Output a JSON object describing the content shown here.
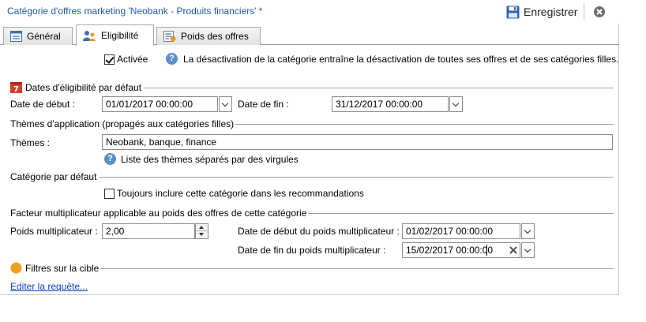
{
  "window": {
    "title": "Catégorie d'offres marketing 'Neobank - Produits financiers' *",
    "save_label": "Enregistrer",
    "accent_color": "#1f5aa8"
  },
  "tabs": [
    {
      "label": "Général",
      "icon": "general-icon",
      "active": false
    },
    {
      "label": "Eligibilité",
      "icon": "eligibility-icon",
      "active": true
    },
    {
      "label": "Poids des offres",
      "icon": "weight-icon",
      "active": false
    }
  ],
  "activation": {
    "label": "Activée",
    "checked": true,
    "info": "La désactivation de la catégorie entraîne la désactivation de toutes ses offres et de ses catégories filles."
  },
  "dates": {
    "section": "Dates d'éligibilité par défaut",
    "start_label": "Date de début :",
    "start_value": "01/01/2017 00:00:00",
    "end_label": "Date de fin :",
    "end_value": "31/12/2017 00:00:00"
  },
  "themes": {
    "section": "Thèmes d'application (propagés aux catégories filles)",
    "label": "Thèmes :",
    "value": "Neobank, banque, finance",
    "hint": "Liste des thèmes séparés par des virgules"
  },
  "default_category": {
    "section": "Catégorie par défaut",
    "checkbox_label": "Toujours inclure cette catégorie dans les recommandations",
    "checked": false
  },
  "multiplier": {
    "section": "Facteur multiplicateur applicable au poids des offres de cette catégorie",
    "weight_label": "Poids multiplicateur :",
    "weight_value": "2,00",
    "start_label": "Date de début du poids multiplicateur :",
    "start_value": "01/02/2017 00:00:00",
    "end_label": "Date de fin du poids multiplicateur :",
    "end_value": "15/02/2017 00:00:00"
  },
  "filters": {
    "section": "Filtres sur la cible",
    "link": "Editer la requête...",
    "dot_color": "#f0a020"
  }
}
